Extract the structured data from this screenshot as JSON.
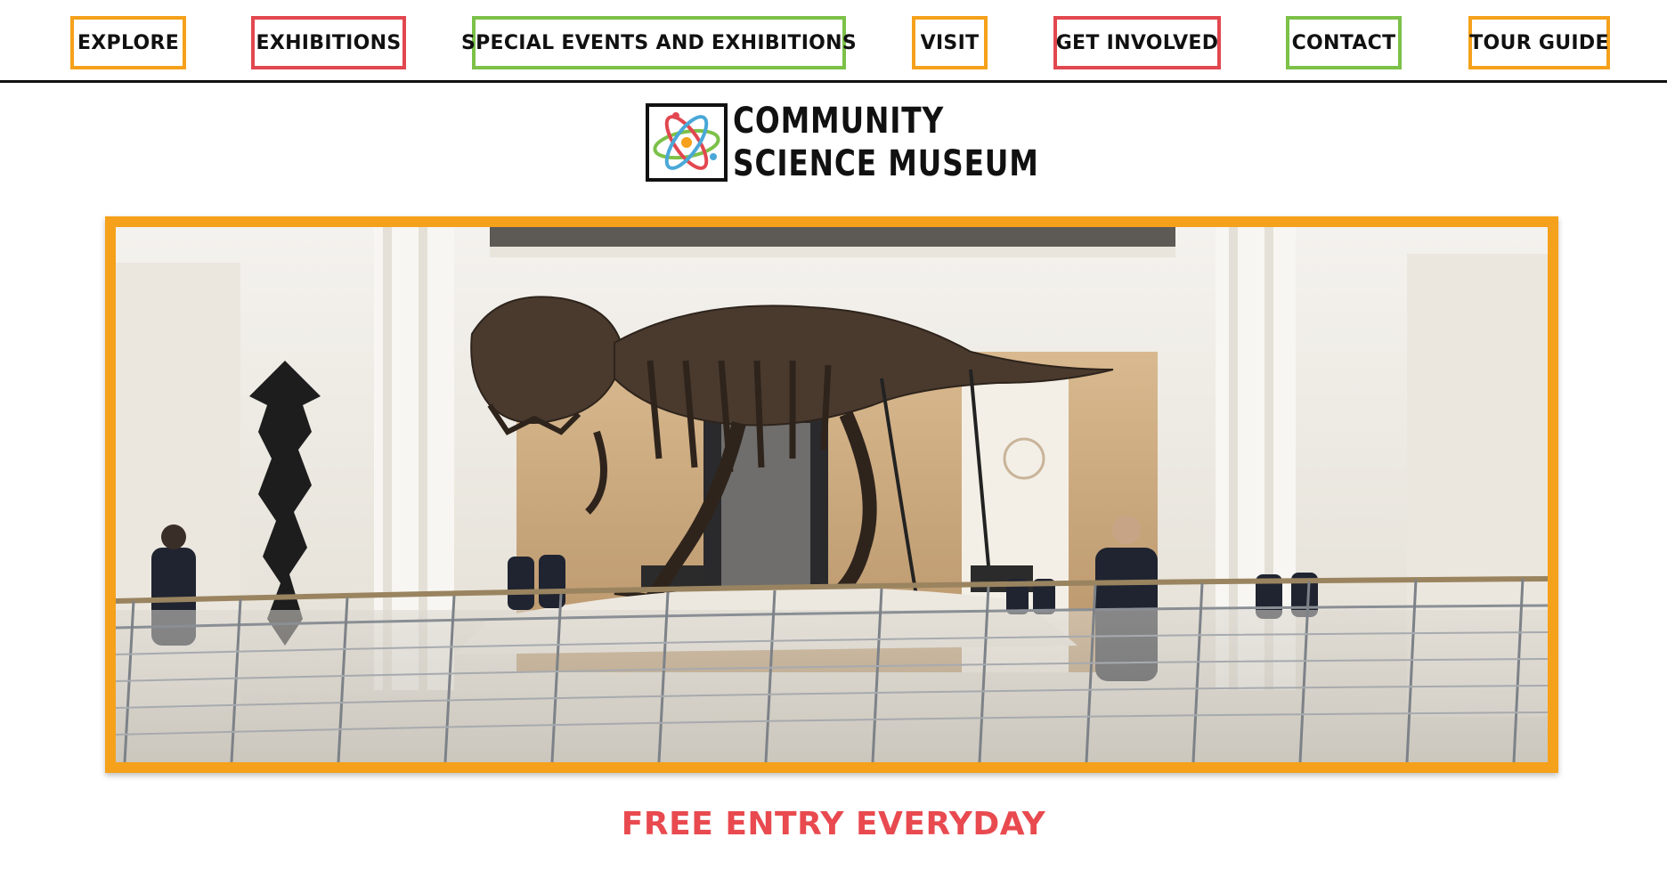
{
  "nav": {
    "items": [
      {
        "label": "EXPLORE",
        "color": "#f5a11b"
      },
      {
        "label": "EXHIBITIONS",
        "color": "#e2474f"
      },
      {
        "label": "SPECIAL EVENTS AND EXHIBITIONS",
        "color": "#7cc148"
      },
      {
        "label": "VISIT",
        "color": "#f5a11b"
      },
      {
        "label": "GET INVOLVED",
        "color": "#e2474f"
      },
      {
        "label": "CONTACT",
        "color": "#7cc148"
      },
      {
        "label": "TOUR GUIDE",
        "color": "#f5a11b"
      }
    ]
  },
  "logo": {
    "line1": "COMMUNITY",
    "line2": "SCIENCE MUSEUM",
    "icon": "atom-icon"
  },
  "hero": {
    "image": "dinosaur-skeleton-museum-hall-photo",
    "frame_color": "#f5a11b"
  },
  "tagline": {
    "text": "FREE ENTRY EVERYDAY",
    "color": "#e84a4f"
  }
}
